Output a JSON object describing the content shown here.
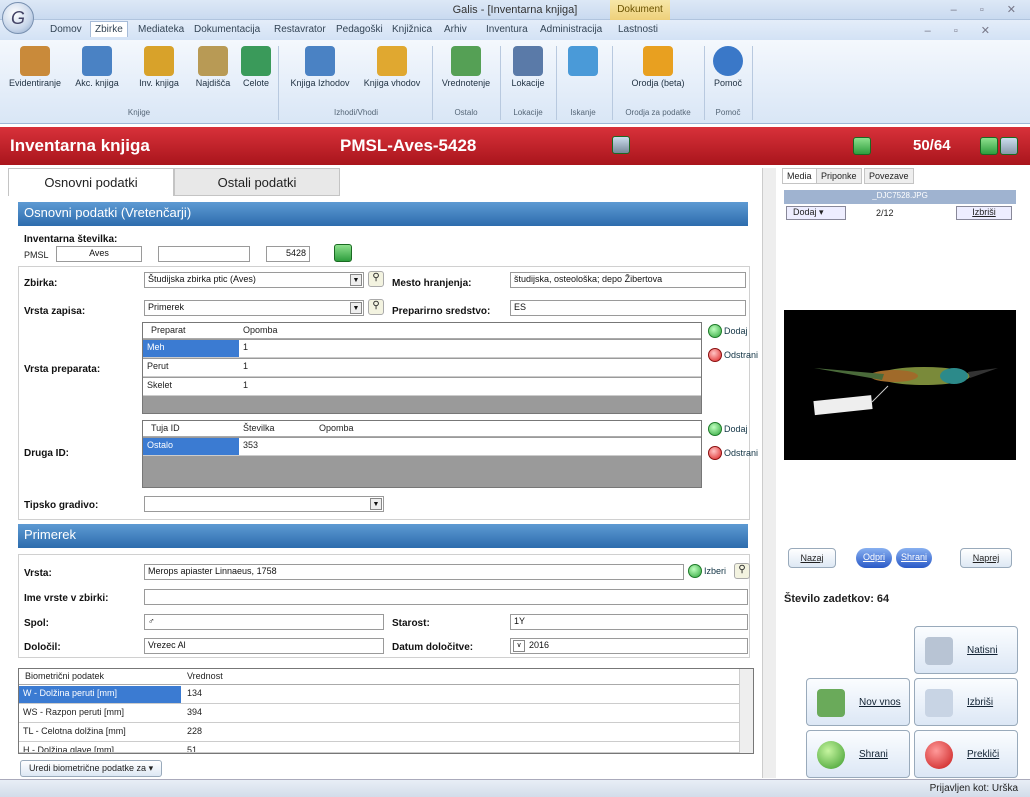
{
  "window": {
    "title": "Galis - [Inventarna knjiga]",
    "context_tab": "Dokument",
    "controls": "– ▫ ✕"
  },
  "menu": [
    "Domov",
    "Zbirke",
    "Mediateka",
    "Dokumentacija",
    "Restavrator",
    "Pedagoški",
    "Knjižnica",
    "Arhiv",
    "Inventura",
    "Administracija",
    "Lastnosti"
  ],
  "menu_selected": "Zbirke",
  "ribbon": {
    "buttons": [
      {
        "label": "Evidentiranje",
        "icon": "register-icon",
        "color": "#c98a3a"
      },
      {
        "label": "Akc. knjiga",
        "icon": "accession-book-icon",
        "color": "#4a82c4"
      },
      {
        "label": "Inv. knjiga",
        "icon": "inventory-book-icon",
        "color": "#d8a22a"
      },
      {
        "label": "Najdišča",
        "icon": "sites-icon",
        "color": "#b89a55"
      },
      {
        "label": "Celote",
        "icon": "collections-icon",
        "color": "#3a9a5a"
      },
      {
        "label": "Knjiga Izhodov",
        "icon": "exit-book-icon",
        "color": "#4a82c4"
      },
      {
        "label": "Knjiga vhodov",
        "icon": "entry-book-icon",
        "color": "#e0a830"
      },
      {
        "label": "Vrednotenje",
        "icon": "valuation-icon",
        "color": "#55a055"
      },
      {
        "label": "Lokacije",
        "icon": "locations-icon",
        "color": "#5a7aa8"
      },
      {
        "label": "Iskanje",
        "icon": "search-icon",
        "color": "#4a9ad8"
      },
      {
        "label": "Orodja (beta)",
        "icon": "tools-icon",
        "color": "#e8a020"
      },
      {
        "label": "Pomoč",
        "icon": "help-icon",
        "color": "#3a78c8"
      }
    ],
    "groups": [
      "Knjige",
      "Izhodi/Vhodi",
      "Ostalo",
      "Lokacije",
      "Iskanje",
      "Orodja za podatke",
      "Pomoč"
    ]
  },
  "header": {
    "title": "Inventarna knjiga",
    "record_code": "PMSL-Aves-5428",
    "counter": "50/64"
  },
  "tabs": [
    "Osnovni podatki",
    "Ostali podatki"
  ],
  "section_basic": "Osnovni podatki (Vretenčarji)",
  "inv": {
    "label": "Inventarna številka:",
    "prefix": "PMSL",
    "part1": "Aves",
    "part2": "",
    "part3": "",
    "number": "5428"
  },
  "fields": {
    "zbirka_label": "Zbirka:",
    "zbirka_value": "Študijska zbirka ptic (Aves)",
    "mesto_label": "Mesto hranjenja:",
    "mesto_value": "študijska, osteološka; depo Žibertova",
    "vrsta_zapisa_label": "Vrsta zapisa:",
    "vrsta_zapisa_value": "Primerek",
    "preparirno_label": "Preparirno sredstvo:",
    "preparirno_value": "ES",
    "vrsta_preparata_label": "Vrsta preparata:",
    "druga_id_label": "Druga ID:",
    "tipsko_label": "Tipsko gradivo:",
    "tipsko_value": ""
  },
  "preparat_grid": {
    "headers": [
      "Preparat",
      "Opomba"
    ],
    "rows": [
      [
        "Meh",
        "1"
      ],
      [
        "Perut",
        "1"
      ],
      [
        "Skelet",
        "1"
      ]
    ]
  },
  "druga_grid": {
    "headers": [
      "Tuja ID",
      "Številka",
      "Opomba"
    ],
    "rows": [
      [
        "Ostalo",
        "353",
        ""
      ]
    ]
  },
  "buttons": {
    "dodaj": "Dodaj",
    "odstrani": "Odstrani",
    "izberi": "Izberi"
  },
  "section_specimen": "Primerek",
  "specimen": {
    "vrsta_label": "Vrsta:",
    "vrsta_value": "Merops apiaster Linnaeus, 1758",
    "ime_label": "Ime vrste v zbirki:",
    "ime_value": "",
    "spol_label": "Spol:",
    "spol_value": "♂",
    "starost_label": "Starost:",
    "starost_value": "1Y",
    "dolocil_label": "Določil:",
    "dolocil_value": "Vrezec Al",
    "datum_label": "Datum določitve:",
    "datum_value": "2016"
  },
  "bio_grid": {
    "headers": [
      "Biometrični podatek",
      "Vrednost"
    ],
    "rows": [
      [
        "W - Dolžina peruti [mm]",
        "134"
      ],
      [
        "WS - Razpon peruti [mm]",
        "394"
      ],
      [
        "TL - Celotna dolžina [mm]",
        "228"
      ],
      [
        "H - Dolžina glave [mm]",
        "51"
      ]
    ],
    "edit_button": "Uredi biometrične podatke za"
  },
  "media": {
    "tabs": [
      "Media",
      "Priponke",
      "Povezave"
    ],
    "filename": "_DJC7528.JPG",
    "add": "Dodaj",
    "pager": "2/12",
    "delete": "Izbriši",
    "nav_back": "Nazaj",
    "open": "Odpri",
    "save": "Shrani",
    "forward": "Naprej"
  },
  "results": "Število zadetkov: 64",
  "actions": {
    "print": "Natisni",
    "new": "Nov vnos",
    "delete": "Izbriši",
    "save": "Shrani",
    "cancel": "Prekliči"
  },
  "status": "Prijavljen kot: Urška"
}
